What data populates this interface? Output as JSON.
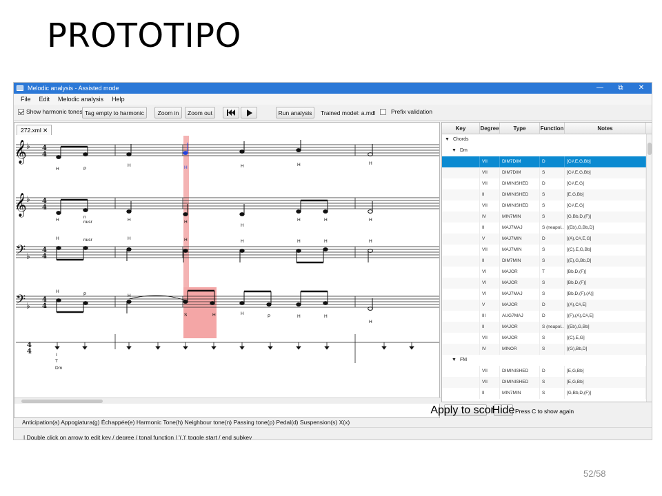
{
  "slide": {
    "title": "PROTOTIPO",
    "page_number": "52/58"
  },
  "window": {
    "title": "Melodic analysis - Assisted mode",
    "minimize": "—",
    "maximize": "⧉",
    "close": "✕"
  },
  "menu": [
    "File",
    "Edit",
    "Melodic analysis",
    "Help"
  ],
  "toolbar": {
    "show_harmonic_tones": "Show harmonic tones",
    "tag_empty": "Tag empty to harmonic",
    "zoom_in": "Zoom in",
    "zoom_out": "Zoom out",
    "run_analysis": "Run analysis",
    "trained_model": "Trained model: a.mdl",
    "prefix_validation": "Prefix validation"
  },
  "score": {
    "tab": "272.xml ✕",
    "row1_tags": [
      "H",
      "P",
      "H",
      "H",
      "H",
      "H",
      "H"
    ],
    "row2_tags": [
      "H",
      "H",
      "H",
      "H",
      "H",
      "H",
      "H",
      "H"
    ],
    "row2_extra": [
      "n",
      "nusr"
    ],
    "row3_tags": [
      "H",
      "H",
      "H",
      "H",
      "H",
      "H",
      "H",
      "H"
    ],
    "row3_extra": [
      "nusr"
    ],
    "row4_tags_top": [
      "H",
      "H"
    ],
    "row4_p": "P",
    "row4_tags_bottom": [
      "S",
      "H",
      "H",
      "P",
      "H",
      "H",
      "H"
    ],
    "analysis": {
      "degree": "I",
      "function": "T",
      "key": "Dm"
    }
  },
  "status": {
    "legend": "Anticipation(a)  Appogiatura(g)  Échappée(e)  Harmonic Tone(h)  Neighbour tone(n)  Passing tone(p)  Pedal(d)  Suspension(s)  X(x)",
    "hint": "| Double click on arrow to edit key / degree / tonal function   | '(,)' toggle start / end subkey"
  },
  "tree": {
    "columns": [
      "Key",
      "Degree",
      "Type",
      "Function",
      "Notes"
    ],
    "root": "Chords",
    "groups": [
      {
        "key": "Dm",
        "rows": [
          {
            "degree": "VII",
            "type": "DIM7DIM",
            "function": "D",
            "notes": "[C#,E,G,Bb]",
            "selected": true
          },
          {
            "degree": "VII",
            "type": "DIM7DIM",
            "function": "S",
            "notes": "[C#,E,G,Bb]"
          },
          {
            "degree": "VII",
            "type": "DIMINISHED",
            "function": "D",
            "notes": "[C#,E,G]"
          },
          {
            "degree": "II",
            "type": "DIMINISHED",
            "function": "S",
            "notes": "[E,G,Bb]"
          },
          {
            "degree": "VII",
            "type": "DIMINISHED",
            "function": "S",
            "notes": "[C#,E,G]"
          },
          {
            "degree": "IV",
            "type": "MIN7MIN",
            "function": "S",
            "notes": "[G,Bb,D,(F)]"
          },
          {
            "degree": "II",
            "type": "MAJ7MAJ",
            "function": "S (neapol...",
            "notes": "[(Eb),G,Bb,D]"
          },
          {
            "degree": "V",
            "type": "MAJ7MIN",
            "function": "D",
            "notes": "[(A),C#,E,G]"
          },
          {
            "degree": "VII",
            "type": "MAJ7MIN",
            "function": "S",
            "notes": "[(C),E,G,Bb]"
          },
          {
            "degree": "II",
            "type": "DIM7MIN",
            "function": "S",
            "notes": "[(E),G,Bb,D]"
          },
          {
            "degree": "VI",
            "type": "MAJOR",
            "function": "T",
            "notes": "[Bb,D,(F)]"
          },
          {
            "degree": "VI",
            "type": "MAJOR",
            "function": "S",
            "notes": "[Bb,D,(F)]"
          },
          {
            "degree": "VI",
            "type": "MAJ7MAJ",
            "function": "S",
            "notes": "[Bb,D,(F),(A)]"
          },
          {
            "degree": "V",
            "type": "MAJOR",
            "function": "D",
            "notes": "[(A),C#,E]"
          },
          {
            "degree": "III",
            "type": "AUG7MAJ",
            "function": "D",
            "notes": "[(F),(A),C#,E]"
          },
          {
            "degree": "II",
            "type": "MAJOR",
            "function": "S (neapol...",
            "notes": "[(Eb),G,Bb]"
          },
          {
            "degree": "VII",
            "type": "MAJOR",
            "function": "S",
            "notes": "[(C),E,G]"
          },
          {
            "degree": "IV",
            "type": "MINOR",
            "function": "S",
            "notes": "[(G),Bb,D]"
          }
        ]
      },
      {
        "key": "FM",
        "rows": [
          {
            "degree": "VII",
            "type": "DIMINISHED",
            "function": "D",
            "notes": "[E,G,Bb]"
          },
          {
            "degree": "VII",
            "type": "DIMINISHED",
            "function": "S",
            "notes": "[E,G,Bb]"
          },
          {
            "degree": "II",
            "type": "MIN7MIN",
            "function": "S",
            "notes": "[G,Bb,D,(F)]"
          }
        ]
      }
    ]
  },
  "actions": {
    "apply": "Apply to score",
    "hide": "Hide",
    "hint": "Press C to show again"
  },
  "colors": {
    "selection": "#0b8ad1",
    "highlight": "#f4a6a6",
    "titlebar": "#2b78d7",
    "note_blue": "#2244dd"
  }
}
